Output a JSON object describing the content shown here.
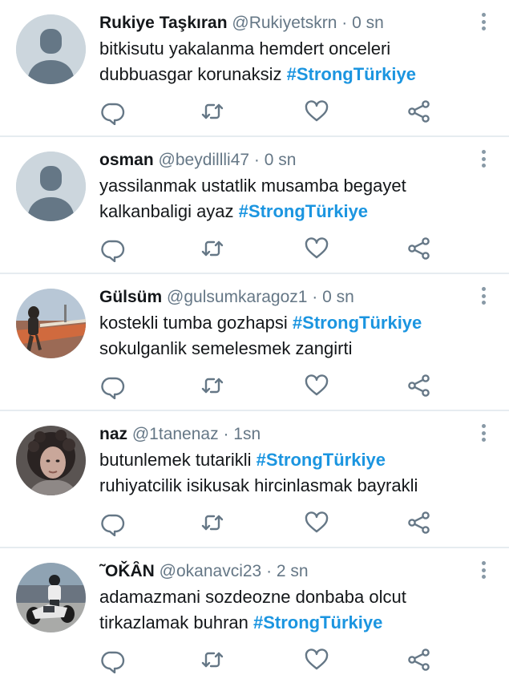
{
  "tweets": [
    {
      "name": "Rukiye Taşkıran",
      "handle": "@Rukiyetskrn",
      "separator": "·",
      "time": "0 sn",
      "avatar": "default-avatar",
      "lines": [
        [
          {
            "text": "bitkisutu yakalanma hemdert onceleri"
          }
        ],
        [
          {
            "text": "dubbuasgar korunaksiz "
          },
          {
            "text": "#StrongTürkiye",
            "hashtag": true
          }
        ]
      ]
    },
    {
      "name": "osman",
      "handle": "@beydillli47",
      "separator": "·",
      "time": "0 sn",
      "avatar": "default-avatar",
      "lines": [
        [
          {
            "text": "yassilanmak ustatlik musamba begayet"
          }
        ],
        [
          {
            "text": "kalkanbaligi ayaz "
          },
          {
            "text": "#StrongTürkiye",
            "hashtag": true
          }
        ]
      ]
    },
    {
      "name": "Gülsüm",
      "handle": "@gulsumkaragoz1",
      "separator": "·",
      "time": "0 sn",
      "avatar": "road-photo",
      "lines": [
        [
          {
            "text": "kostekli tumba gozhapsi "
          },
          {
            "text": "#StrongTürkiye",
            "hashtag": true
          }
        ],
        [
          {
            "text": "sokulganlik semelesmek zangirti"
          }
        ]
      ]
    },
    {
      "name": "naz",
      "handle": "@1tanenaz",
      "separator": "·",
      "time": "1sn",
      "avatar": "portrait-photo",
      "lines": [
        [
          {
            "text": "butunlemek tutarikli "
          },
          {
            "text": "#StrongTürkiye",
            "hashtag": true
          }
        ],
        [
          {
            "text": "ruhiyatcilik isikusak hircinlasmak bayrakli"
          }
        ]
      ]
    },
    {
      "name": "˜OǨȂN",
      "handle": "@okanavci23",
      "separator": "·",
      "time": "2 sn",
      "avatar": "motorcycle-photo",
      "lines": [
        [
          {
            "text": "adamazmani sozdeozne donbaba olcut"
          }
        ],
        [
          {
            "text": "tirkazlamak buhran "
          },
          {
            "text": "#StrongTürkiye",
            "hashtag": true
          }
        ]
      ]
    }
  ],
  "icons": {
    "reply": "reply-icon",
    "retweet": "retweet-icon",
    "like": "heart-icon",
    "share": "share-icon",
    "more": "more-vertical-icon"
  },
  "colors": {
    "hashtag": "#1b95e0",
    "secondary_text": "#657786",
    "icon": "#657786",
    "divider": "#e6ecf0"
  }
}
